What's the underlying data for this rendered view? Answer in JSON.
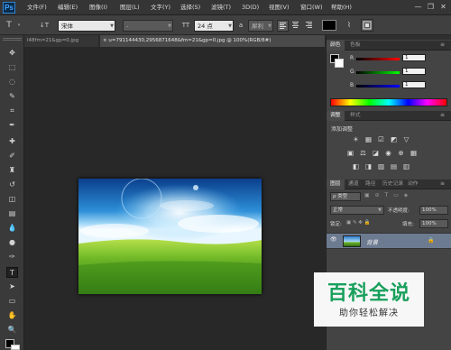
{
  "app": {
    "logo_text": "Ps"
  },
  "menu": {
    "items": [
      "文件(F)",
      "编辑(E)",
      "图像(I)",
      "图层(L)",
      "文字(Y)",
      "选择(S)",
      "滤镜(T)",
      "3D(D)",
      "视图(V)",
      "窗口(W)",
      "帮助(H)"
    ]
  },
  "window_controls": {
    "minimize": "—",
    "restore": "❐",
    "close": "✕"
  },
  "options_bar": {
    "tool_icon": "T",
    "orient_icon": "↓T",
    "font_family": "宋体",
    "font_style": "-",
    "size_icon": "TT",
    "font_size": "24 点",
    "antialias_icon": "a",
    "antialias": "犀利",
    "text_color": "#000000"
  },
  "tabs": [
    {
      "label": "l48fm=21&gp=0.jpg",
      "active": false
    },
    {
      "label": "u=791144430,2956871648&fm=21&gp=0.jpg @ 100%(RGB/8#)",
      "active": true
    }
  ],
  "tab_close": "×",
  "color_panel": {
    "tabs": [
      "颜色",
      "色板"
    ],
    "channels": [
      {
        "label": "R",
        "value": "1"
      },
      {
        "label": "G",
        "value": "1"
      },
      {
        "label": "B",
        "value": "1"
      }
    ]
  },
  "adjustments_panel": {
    "tabs": [
      "调整",
      "样式"
    ],
    "title": "添加调整",
    "row1_icons": [
      "☀",
      "▦",
      "☑",
      "◩",
      "▽"
    ],
    "row2_icons": [
      "▣",
      "⚖",
      "◪",
      "◉",
      "⊕",
      "▦"
    ],
    "row3_icons": [
      "◧",
      "◨",
      "▨",
      "▤",
      "▥"
    ]
  },
  "layers_panel": {
    "tabs": [
      "图层",
      "通道",
      "路径",
      "历史记录",
      "动作"
    ],
    "filter_label": "ρ 类型",
    "blend_mode": "正常",
    "opacity_label": "不透明度:",
    "opacity_value": "100%",
    "lock_label": "锁定:",
    "lock_icons": "▣ ✎ ✥ 🔒",
    "fill_label": "填充:",
    "fill_value": "100%",
    "layers": [
      {
        "name": "背景",
        "locked": true,
        "visible": true
      }
    ],
    "eye_icon": "👁",
    "lock_icon": "🔒"
  },
  "watermark": {
    "title": "百科全说",
    "subtitle": "助你轻松解决"
  }
}
